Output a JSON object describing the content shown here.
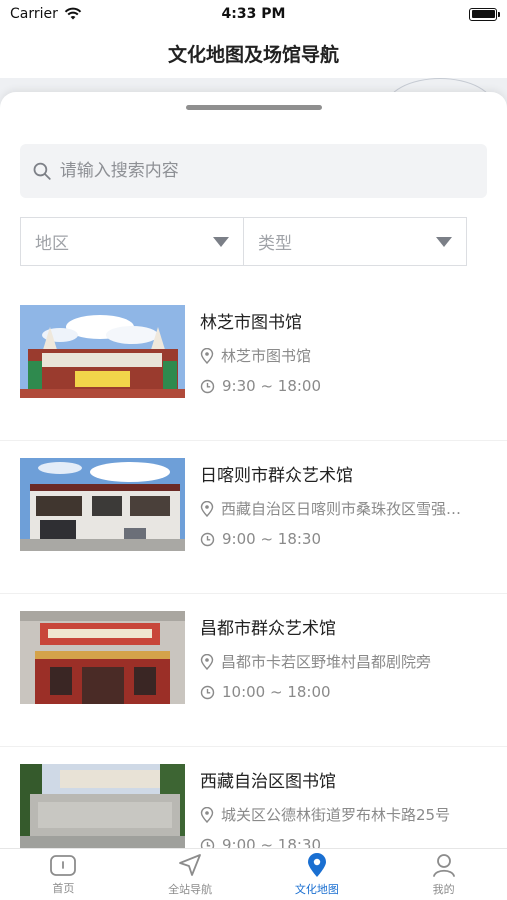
{
  "status": {
    "carrier": "Carrier",
    "time": "4:33 PM",
    "battery_level": 1.0
  },
  "nav": {
    "title": "文化地图及场馆导航"
  },
  "search": {
    "placeholder": "请输入搜索内容"
  },
  "filters": [
    {
      "label": "地区"
    },
    {
      "label": "类型"
    }
  ],
  "venues": [
    {
      "name": "林芝市图书馆",
      "address": "林芝市图书馆",
      "hours": "9:30 ~ 18:00"
    },
    {
      "name": "日喀则市群众艺术馆",
      "address": "西藏自治区日喀则市桑珠孜区雪强…",
      "hours": "9:00 ~ 18:30"
    },
    {
      "name": "昌都市群众艺术馆",
      "address": "昌都市卡若区野堆村昌都剧院旁",
      "hours": "10:00 ~ 18:00"
    },
    {
      "name": "西藏自治区图书馆",
      "address": "城关区公德林街道罗布林卡路25号",
      "hours": "9:00 ~ 18:30"
    }
  ],
  "tabs": [
    {
      "label": "首页",
      "icon": "home-icon"
    },
    {
      "label": "全站导航",
      "icon": "navigation-arrow-icon"
    },
    {
      "label": "文化地图",
      "icon": "map-pin-icon",
      "active": true
    },
    {
      "label": "我的",
      "icon": "user-icon"
    }
  ],
  "colors": {
    "accent": "#1a6fd1",
    "muted": "#8a8a8a"
  }
}
